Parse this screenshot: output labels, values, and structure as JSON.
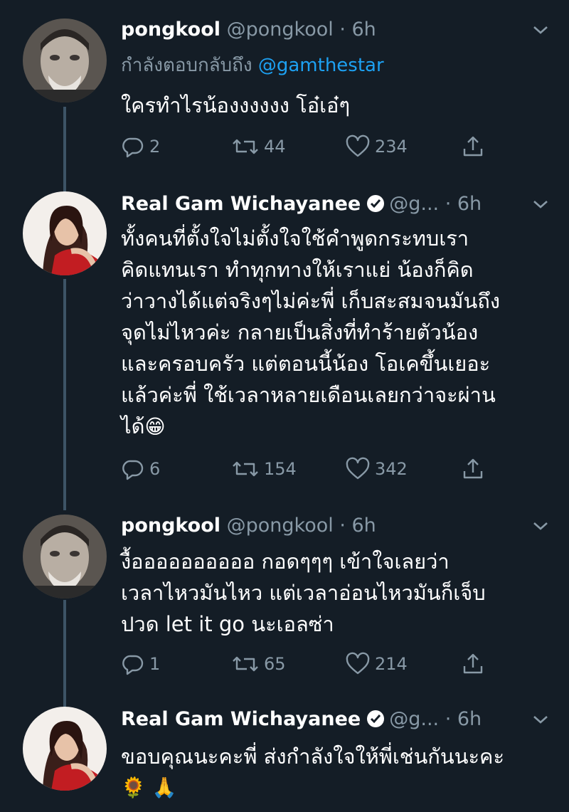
{
  "tweets": [
    {
      "name": "pongkool",
      "handle": "@pongkool",
      "time": "· 6h",
      "reply_prefix": "กำลังตอบกลับถึง",
      "reply_mention": "@gamthestar",
      "text": "ใครทำไรน้องงงงงง โอ๋เอ๋ๆ",
      "replies": "2",
      "retweets": "44",
      "likes": "234",
      "verified": false
    },
    {
      "name": "Real Gam Wichayanee",
      "handle": "@g...",
      "time": "· 6h",
      "text": "ทั้งคนที่ตั้งใจไม่ตั้งใจใช้คำพูดกระทบเรา\nคิดแทนเรา ทำทุกทางให้เราแย่ น้องก็คิด\nว่าวางได้แต่จริงๆไม่ค่ะพี่ เก็บสะสมจนมันถึง\nจุดไม่ไหวค่ะ  กลายเป็นสิ่งที่ทำร้ายตัวน้อง\nและครอบครัว แต่ตอนนี้น้อง โอเคขึ้นเยอะ\nแล้วค่ะพี่  ใช้เวลาหลายเดือนเลยกว่าจะผ่าน\nได้",
      "emoji": "😁",
      "replies": "6",
      "retweets": "154",
      "likes": "342",
      "verified": true
    },
    {
      "name": "pongkool",
      "handle": "@pongkool",
      "time": "· 6h",
      "text": "งื้ออออออออออ กอดๆๆๆ เข้าใจเลยว่า\nเวลาไหวมันไหว แต่เวลาอ่อนไหวมันก็เจ็บ\nปวด let it go นะเอลซ่า",
      "replies": "1",
      "retweets": "65",
      "likes": "214",
      "verified": false
    },
    {
      "name": "Real Gam Wichayanee",
      "handle": "@g...",
      "time": "· 6h",
      "text": "ขอบคุณนะคะพี่ ส่งกำลังใจให้พี่เช่นกันนะคะ",
      "emoji": "🌻 🙏",
      "verified": true
    }
  ],
  "colors": {
    "background": "#141d26",
    "text_primary": "#ffffff",
    "text_secondary": "#8899a6",
    "mention": "#1da1f2",
    "thread_line": "#3d5466"
  },
  "icons": [
    "reply-icon",
    "retweet-icon",
    "like-icon",
    "share-icon",
    "verified-badge-icon",
    "chevron-down-icon"
  ]
}
